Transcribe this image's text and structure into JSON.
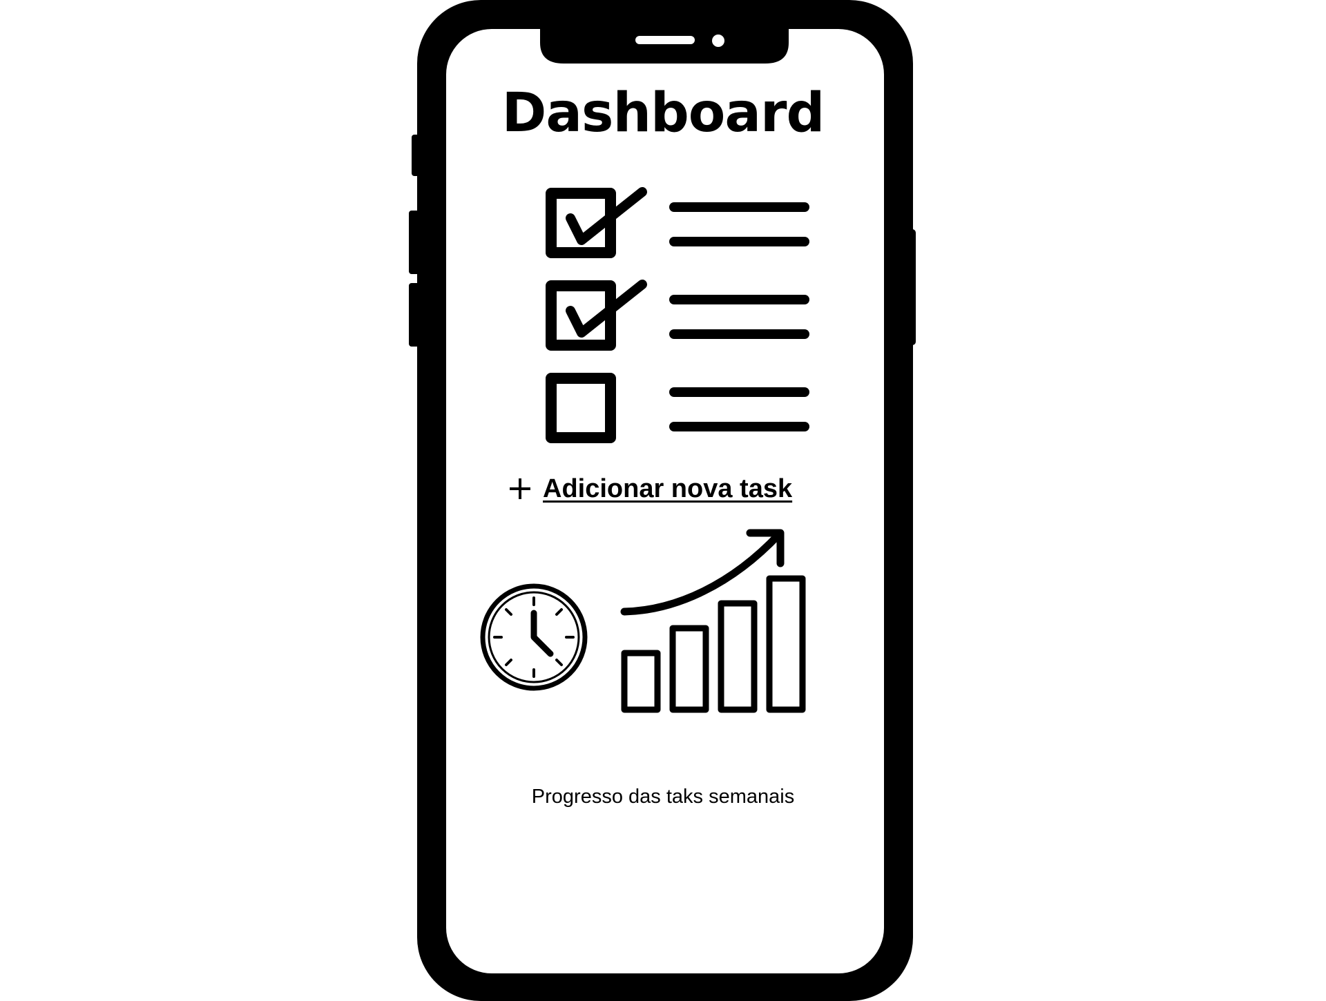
{
  "screen": {
    "title": "Dashboard",
    "add_task_label": "Adicionar nova task",
    "progress_caption": "Progresso das taks semanais"
  },
  "tasks": [
    {
      "checked": true
    },
    {
      "checked": true
    },
    {
      "checked": false
    }
  ],
  "icons": {
    "add": "plus-icon",
    "clock": "clock-icon",
    "chart": "bar-chart-icon",
    "trend": "trend-arrow-icon",
    "checkbox_checked": "checkbox-checked-icon",
    "checkbox_empty": "checkbox-empty-icon"
  },
  "colors": {
    "ink": "#000000",
    "screen": "#ffffff"
  }
}
